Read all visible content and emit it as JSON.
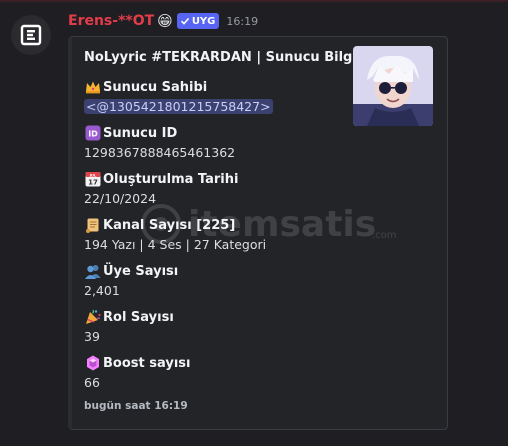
{
  "message": {
    "username": "Erens-**OT",
    "emoji": "😁",
    "badge_label": "UYG",
    "timestamp": "16:19"
  },
  "embed": {
    "title": "NoLyyric #TEKRARDAN | Sunucu Bilgileri",
    "fields": [
      {
        "icon": "crown-icon",
        "name": "Sunucu Sahibi",
        "value": "<@1305421801215758427>"
      },
      {
        "icon": "id-icon",
        "name": "Sunucu ID",
        "value": "1298367888465461362"
      },
      {
        "icon": "calendar-icon",
        "name": "Oluşturulma Tarihi",
        "value": "22/10/2024"
      },
      {
        "icon": "scroll-icon",
        "name": "Kanal Sayısı [225]",
        "value": "194 Yazı | 4 Ses | 27 Kategori"
      },
      {
        "icon": "users-icon",
        "name": "Üye Sayısı",
        "value": "2,401"
      },
      {
        "icon": "party-popper-icon",
        "name": "Rol Sayısı",
        "value": "39"
      },
      {
        "icon": "boost-gem-icon",
        "name": "Boost sayısı",
        "value": "66"
      }
    ],
    "footer": "bugün saat 16:19"
  },
  "calendar_icon_text": {
    "month": "JUL",
    "day": "17"
  },
  "watermark": {
    "text": "itemsatis",
    "domain": ".com"
  },
  "colors": {
    "username": "#e23c4a",
    "badge": "#5865f2",
    "mention_bg": "#3c4270",
    "embed_bg": "#232428",
    "page_bg": "#1f1f23"
  }
}
